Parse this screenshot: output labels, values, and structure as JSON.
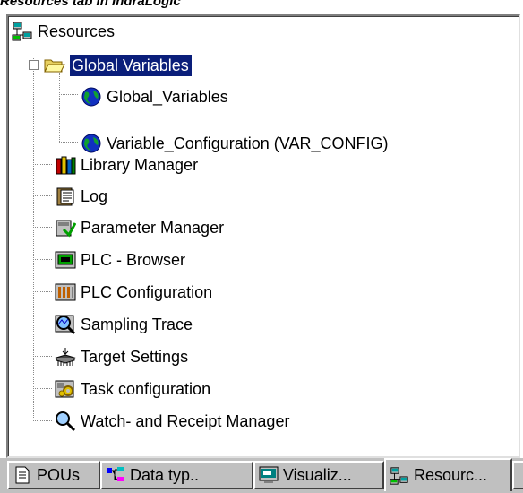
{
  "caption": "Resources tab in IndraLogic",
  "tree": {
    "root": {
      "label": "Resources",
      "icon": "resources-icon"
    },
    "global_variables": {
      "label": "Global Variables",
      "icon": "open-folder-icon",
      "children": [
        {
          "label": "Global_Variables",
          "icon": "globe-icon"
        },
        {
          "label": "Variable_Configuration (VAR_CONFIG)",
          "icon": "globe-icon"
        }
      ]
    },
    "items": [
      {
        "label": "Library Manager",
        "icon": "library-books-icon"
      },
      {
        "label": "Log",
        "icon": "log-book-icon"
      },
      {
        "label": "Parameter Manager",
        "icon": "parameter-manager-icon"
      },
      {
        "label": "PLC - Browser",
        "icon": "plc-browser-icon"
      },
      {
        "label": "PLC Configuration",
        "icon": "plc-configuration-icon"
      },
      {
        "label": "Sampling Trace",
        "icon": "magnifier-chart-icon"
      },
      {
        "label": "Target Settings",
        "icon": "target-settings-icon"
      },
      {
        "label": "Task configuration",
        "icon": "task-configuration-icon"
      },
      {
        "label": "Watch- and Receipt Manager",
        "icon": "magnifier-icon"
      }
    ]
  },
  "tabs": [
    {
      "label": "POUs",
      "icon": "document-icon"
    },
    {
      "label": "Data typ..",
      "icon": "data-types-icon"
    },
    {
      "label": "Visualiz...",
      "icon": "visualization-icon"
    },
    {
      "label": "Resourc...",
      "icon": "resources-icon",
      "active": true
    }
  ],
  "colors": {
    "selection": "#0a1e7a",
    "panel_bg": "#ffffff",
    "tab_bg": "#c0c0c0"
  }
}
